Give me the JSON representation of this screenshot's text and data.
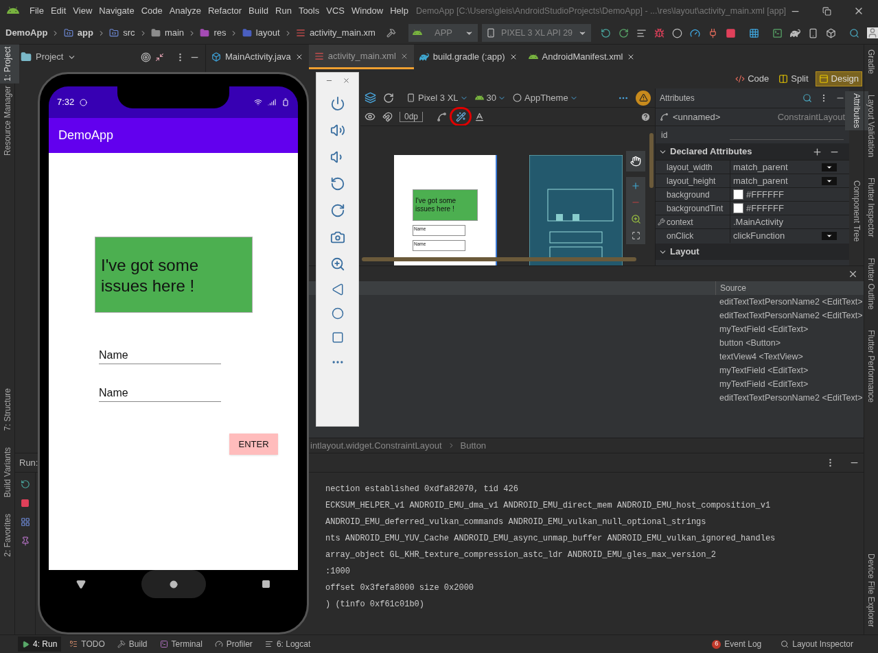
{
  "menu": [
    "File",
    "Edit",
    "View",
    "Navigate",
    "Code",
    "Analyze",
    "Refactor",
    "Build",
    "Run",
    "Tools",
    "VCS",
    "Window",
    "Help"
  ],
  "window_title": "DemoApp [C:\\Users\\gleis\\AndroidStudioProjects\\DemoApp] - ...\\res\\layout\\activity_main.xml [app]",
  "breadcrumbs": [
    {
      "label": "DemoApp",
      "kind": "project"
    },
    {
      "label": "app",
      "kind": "module"
    },
    {
      "label": "src",
      "kind": "module"
    },
    {
      "label": "main",
      "kind": "folder"
    },
    {
      "label": "res",
      "kind": "res"
    },
    {
      "label": "layout",
      "kind": "layout"
    },
    {
      "label": "activity_main.xm",
      "kind": "layout-file"
    }
  ],
  "run_config": "APP",
  "device": "PIXEL 3 XL API 29",
  "left_stripe_top": [
    {
      "label": "1: Project",
      "selected": true
    },
    {
      "label": "Resource Manager",
      "selected": false
    }
  ],
  "left_stripe_bottom": [
    {
      "label": "7: Structure",
      "selected": false
    },
    {
      "label": "Build Variants",
      "selected": false
    },
    {
      "label": "2: Favorites",
      "selected": false
    }
  ],
  "right_stripe": [
    {
      "label": "Gradle"
    },
    {
      "label": "Layout Validation"
    },
    {
      "label": "Flutter Inspector"
    },
    {
      "label": "Flutter Outline"
    },
    {
      "label": "Flutter Performance"
    },
    {
      "label": "Device File Explorer"
    }
  ],
  "attr_stripe": [
    {
      "label": "Attributes",
      "selected": true
    },
    {
      "label": "Component Tree",
      "selected": false
    }
  ],
  "project_panel": {
    "title": "Project"
  },
  "editor_tabs": [
    {
      "label": "MainActivity.java",
      "selected": false,
      "kind": "java"
    },
    {
      "label": "activity_main.xml",
      "selected": true,
      "kind": "layout"
    },
    {
      "label": "build.gradle (:app)",
      "selected": false,
      "kind": "gradle"
    },
    {
      "label": "AndroidManifest.xml",
      "selected": false,
      "kind": "manifest"
    }
  ],
  "view_modes": [
    {
      "label": "Code",
      "selected": false,
      "kind": "code"
    },
    {
      "label": "Split",
      "selected": false,
      "kind": "split"
    },
    {
      "label": "Design",
      "selected": true,
      "kind": "design"
    }
  ],
  "design_toolbar": {
    "device": "Pixel 3 XL",
    "api": "30",
    "theme": "AppTheme",
    "margin": "0dp"
  },
  "preview": {
    "text": "I've got some issues here !",
    "fields": [
      "Name",
      "Name"
    ]
  },
  "attributes": {
    "title": "Attributes",
    "component": "<unnamed>",
    "component_type": "ConstraintLayout",
    "id_label": "id",
    "section": "Declared Attributes",
    "rows": [
      {
        "name": "layout_width",
        "value": "match_parent",
        "kind": "dropdown"
      },
      {
        "name": "layout_height",
        "value": "match_parent",
        "kind": "dropdown"
      },
      {
        "name": "background",
        "value": "#FFFFFF",
        "kind": "color"
      },
      {
        "name": "backgroundTint",
        "value": "#FFFFFF",
        "kind": "color"
      },
      {
        "name": "context",
        "value": ".MainActivity",
        "kind": "reference"
      },
      {
        "name": "onClick",
        "value": "clickFunction",
        "kind": "dropdown"
      }
    ],
    "next_section": "Layout"
  },
  "issues": {
    "column": "Source",
    "rows": [
      "editTextTextPersonName2 <EditText>",
      "editTextTextPersonName2 <EditText>",
      "myTextField <EditText>",
      "button <Button>",
      "textView4 <TextView>",
      "myTextField <EditText>",
      "myTextField <EditText>",
      "editTextTextPersonName2 <EditText>"
    ]
  },
  "layout_path": [
    "intlayout.widget.ConstraintLayout",
    "Button"
  ],
  "run_panel": {
    "label": "Run:",
    "console": [
      "nection established 0xdfa82070, tid 426",
      "ECKSUM_HELPER_v1 ANDROID_EMU_dma_v1 ANDROID_EMU_direct_mem ANDROID_EMU_host_composition_v1",
      "ANDROID_EMU_deferred_vulkan_commands ANDROID_EMU_vulkan_null_optional_strings",
      "nts ANDROID_EMU_YUV_Cache ANDROID_EMU_async_unmap_buffer ANDROID_EMU_vulkan_ignored_handles",
      "array_object GL_KHR_texture_compression_astc_ldr ANDROID_EMU_gles_max_version_2",
      ":1000",
      "offset 0x3fefa8000 size 0x2000",
      ") (tinfo 0xf61c01b0)"
    ]
  },
  "emulator": {
    "time": "7:32",
    "app_title": "DemoApp",
    "message": "I've got some issues here !",
    "fields": [
      "Name",
      "Name"
    ],
    "button": "ENTER"
  },
  "status_left": [
    {
      "label": "4: Run",
      "selected": true,
      "kind": "run"
    },
    {
      "label": "TODO",
      "selected": false,
      "kind": "todo"
    },
    {
      "label": "Build",
      "selected": false,
      "kind": "build"
    },
    {
      "label": "Terminal",
      "selected": false,
      "kind": "terminal"
    },
    {
      "label": "Profiler",
      "selected": false,
      "kind": "profiler"
    },
    {
      "label": "6: Logcat",
      "selected": false,
      "kind": "logcat"
    }
  ],
  "status_right": [
    {
      "label": "Event Log",
      "badge": "6"
    },
    {
      "label": "Layout Inspector"
    }
  ]
}
